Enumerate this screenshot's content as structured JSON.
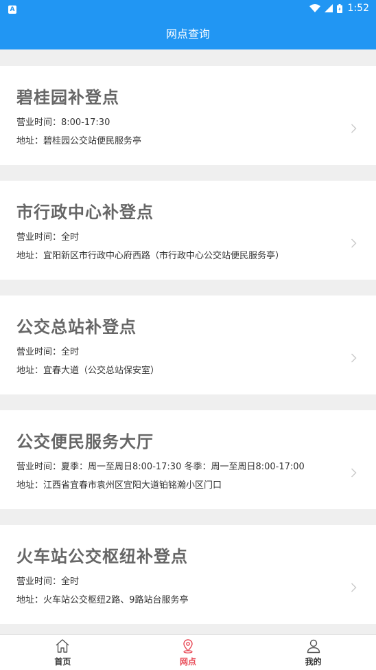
{
  "status_bar": {
    "time": "1:52"
  },
  "header": {
    "title": "网点查询"
  },
  "points": [
    {
      "name": "碧桂园补登点",
      "hours": "营业时间：8:00-17:30",
      "address": "地址：碧桂园公交站便民服务亭"
    },
    {
      "name": "市行政中心补登点",
      "hours": "营业时间：全时",
      "address": "地址：宜阳新区市行政中心府西路（市行政中心公交站便民服务亭）"
    },
    {
      "name": "公交总站补登点",
      "hours": "营业时间：全时",
      "address": "地址：宜春大道（公交总站保安室）"
    },
    {
      "name": "公交便民服务大厅",
      "hours": "营业时间：夏季：周一至周日8:00-17:30 冬季：周一至周日8:00-17:00",
      "address": "地址：江西省宜春市袁州区宜阳大道铂铭瀚小区门口"
    },
    {
      "name": "火车站公交枢纽补登点",
      "hours": "营业时间：全时",
      "address": "地址：火车站公交枢纽2路、9路站台服务亭"
    }
  ],
  "tabs": [
    {
      "label": "首页",
      "icon": "home-icon"
    },
    {
      "label": "网点",
      "icon": "location-pin-icon",
      "active": true
    },
    {
      "label": "我的",
      "icon": "user-icon"
    }
  ],
  "colors": {
    "primary": "#2196f3",
    "tab_active": "#e84a57"
  }
}
